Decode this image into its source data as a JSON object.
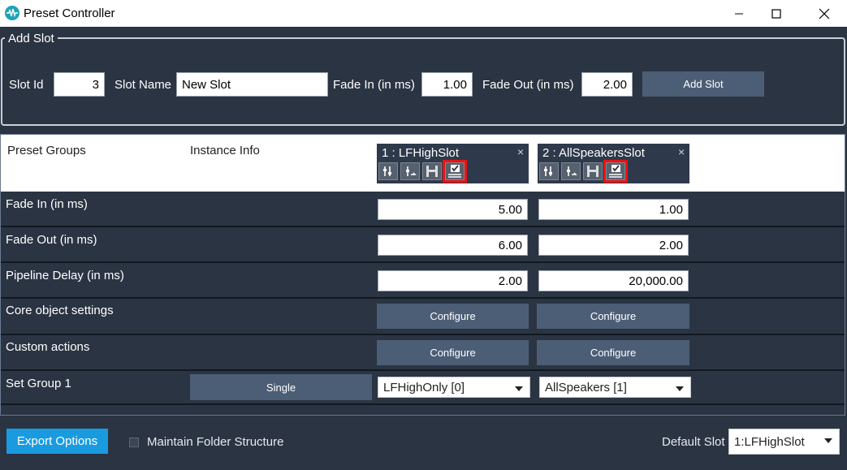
{
  "window": {
    "title": "Preset Controller"
  },
  "add_slot": {
    "legend": "Add Slot",
    "slot_id_label": "Slot Id",
    "slot_id_value": "3",
    "slot_name_label": "Slot Name",
    "slot_name_value": "New Slot",
    "fade_in_label": "Fade In (in ms)",
    "fade_in_value": "1.00",
    "fade_out_label": "Fade Out (in ms)",
    "fade_out_value": "2.00",
    "add_button": "Add Slot"
  },
  "table": {
    "header": {
      "preset_groups": "Preset Groups",
      "instance_info": "Instance Info"
    },
    "slots": [
      {
        "title": "1 : LFHighSlot",
        "close": "×",
        "fade_in": "5.00",
        "fade_out": "6.00",
        "pipeline_delay": "2.00",
        "core_btn": "Configure",
        "custom_btn": "Configure",
        "group1": "LFHighOnly [0]"
      },
      {
        "title": "2 : AllSpeakersSlot",
        "close": "×",
        "fade_in": "1.00",
        "fade_out": "2.00",
        "pipeline_delay": "20,000.00",
        "core_btn": "Configure",
        "custom_btn": "Configure",
        "group1": "AllSpeakers [1]"
      }
    ],
    "rows": {
      "fade_in": "Fade In (in ms)",
      "fade_out": "Fade Out (in ms)",
      "pipeline_delay": "Pipeline Delay (in ms)",
      "core": "Core object settings",
      "custom": "Custom actions",
      "set_group": "Set Group 1"
    },
    "single_button": "Single"
  },
  "footer": {
    "export_button": "Export Options",
    "maintain_folder": "Maintain Folder Structure",
    "default_slot_label": "Default Slot",
    "default_slot_value": "1:LFHighSlot"
  }
}
